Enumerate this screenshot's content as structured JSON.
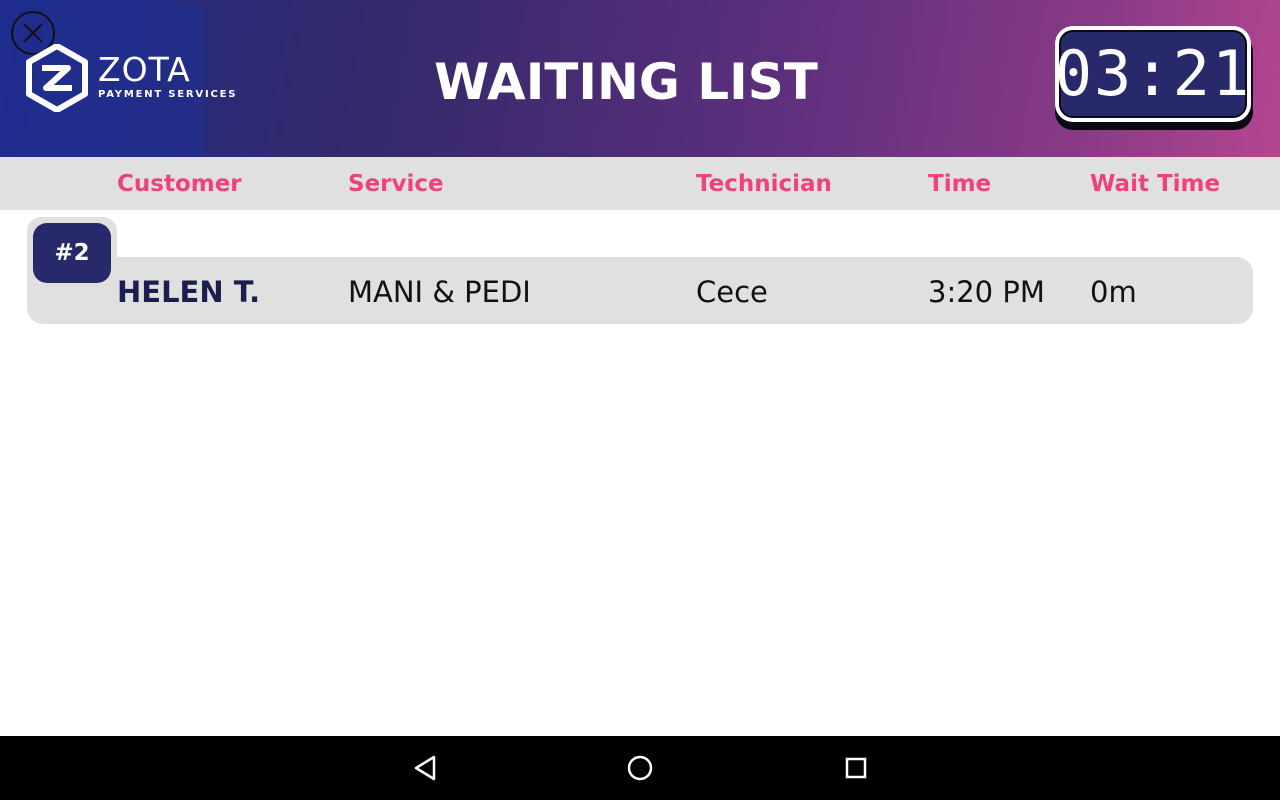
{
  "header": {
    "logo": {
      "name": "ZOTA",
      "subtitle": "PAYMENT SERVICES"
    },
    "title": "WAITING LIST",
    "clock": "03:21"
  },
  "table": {
    "columns": [
      "Customer",
      "Service",
      "Technician",
      "Time",
      "Wait Time"
    ],
    "rows": [
      {
        "number": "#2",
        "customer": "HELEN T.",
        "service": "MANI & PEDI",
        "technician": "Cece",
        "time": "3:20 PM",
        "wait_time": "0m"
      }
    ]
  },
  "colors": {
    "accent_pink": "#f0417f",
    "navy": "#27296b",
    "row_gray": "#e0e0e0",
    "gradient_start": "#1f2c86",
    "gradient_end": "#b4468f"
  },
  "icons": {
    "close": "close-icon",
    "logo_mark": "zota-logo-icon",
    "nav_back": "back-triangle-icon",
    "nav_home": "home-circle-icon",
    "nav_recents": "recents-square-icon"
  }
}
